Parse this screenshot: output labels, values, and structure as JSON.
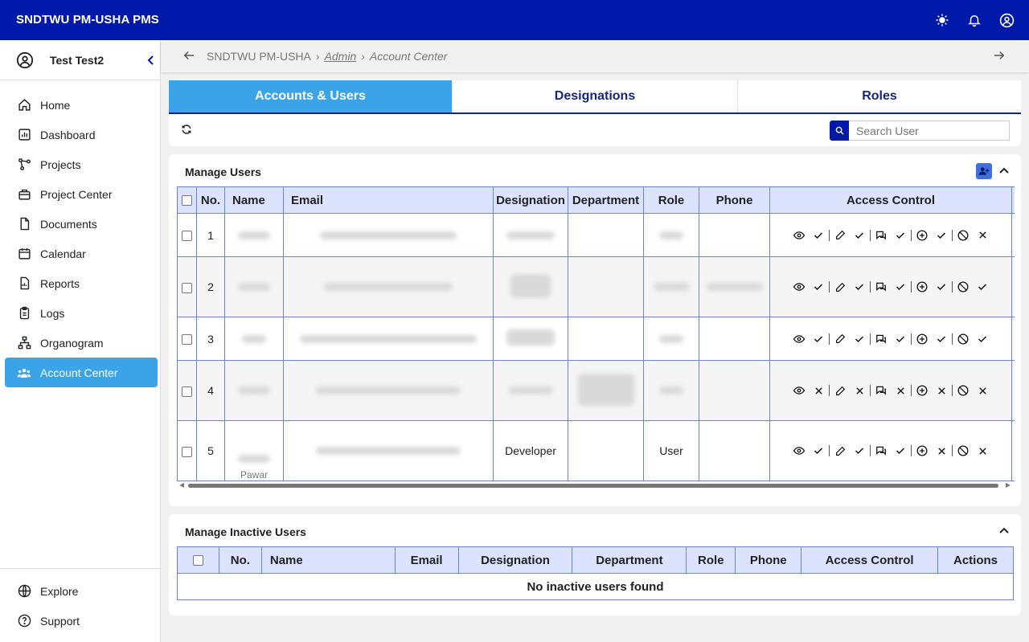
{
  "app": {
    "title": "SNDTWU PM-USHA PMS"
  },
  "topbar": {
    "theme_icon": "sun-icon",
    "notif_icon": "bell-icon",
    "account_icon": "user-circle-icon"
  },
  "sidebar": {
    "user_name": "Test Test2",
    "items": [
      {
        "label": "Home",
        "icon": "home-icon"
      },
      {
        "label": "Dashboard",
        "icon": "chart-icon"
      },
      {
        "label": "Projects",
        "icon": "network-icon"
      },
      {
        "label": "Project Center",
        "icon": "briefcase-icon"
      },
      {
        "label": "Documents",
        "icon": "document-icon"
      },
      {
        "label": "Calendar",
        "icon": "calendar-icon"
      },
      {
        "label": "Reports",
        "icon": "report-icon"
      },
      {
        "label": "Logs",
        "icon": "clipboard-icon"
      },
      {
        "label": "Organogram",
        "icon": "hierarchy-icon"
      },
      {
        "label": "Account Center",
        "icon": "users-icon",
        "active": true
      }
    ],
    "bottom_items": [
      {
        "label": "Explore",
        "icon": "globe-icon"
      },
      {
        "label": "Support",
        "icon": "help-icon"
      }
    ]
  },
  "breadcrumb": {
    "root": "SNDTWU PM-USHA",
    "parent": "Admin",
    "current": "Account Center",
    "sep": "›"
  },
  "tabs": [
    {
      "label": "Accounts & Users",
      "active": true
    },
    {
      "label": "Designations",
      "active": false
    },
    {
      "label": "Roles",
      "active": false
    }
  ],
  "search": {
    "placeholder": "Search User",
    "value": ""
  },
  "manage_users": {
    "title": "Manage Users",
    "columns": [
      "No.",
      "Name",
      "Email",
      "Designation",
      "Department",
      "Role",
      "Phone",
      "Access Control"
    ],
    "rows": [
      {
        "no": "1",
        "designation": "",
        "role": "",
        "acl": [
          "check",
          "check",
          "check",
          "check",
          "cross"
        ]
      },
      {
        "no": "2",
        "designation": "",
        "role": "",
        "acl": [
          "check",
          "check",
          "check",
          "check",
          "check"
        ]
      },
      {
        "no": "3",
        "designation": "",
        "role": "",
        "acl": [
          "check",
          "check",
          "check",
          "check",
          "check"
        ]
      },
      {
        "no": "4",
        "designation": "",
        "role": "",
        "acl": [
          "cross",
          "cross",
          "cross",
          "cross",
          "cross"
        ]
      },
      {
        "no": "5",
        "designation": "Developer",
        "role": "User",
        "name_partial": "Pawar",
        "acl": [
          "check",
          "check",
          "check",
          "cross",
          "cross"
        ]
      }
    ]
  },
  "inactive_users": {
    "title": "Manage Inactive Users",
    "columns": [
      "No.",
      "Name",
      "Email",
      "Designation",
      "Department",
      "Role",
      "Phone",
      "Access Control",
      "Actions"
    ],
    "empty_text": "No inactive users found"
  },
  "colors": {
    "topbar": "#0019a8",
    "accent": "#3ba3e8",
    "table_header": "#dbe3ff",
    "table_border": "#6c84d6"
  }
}
